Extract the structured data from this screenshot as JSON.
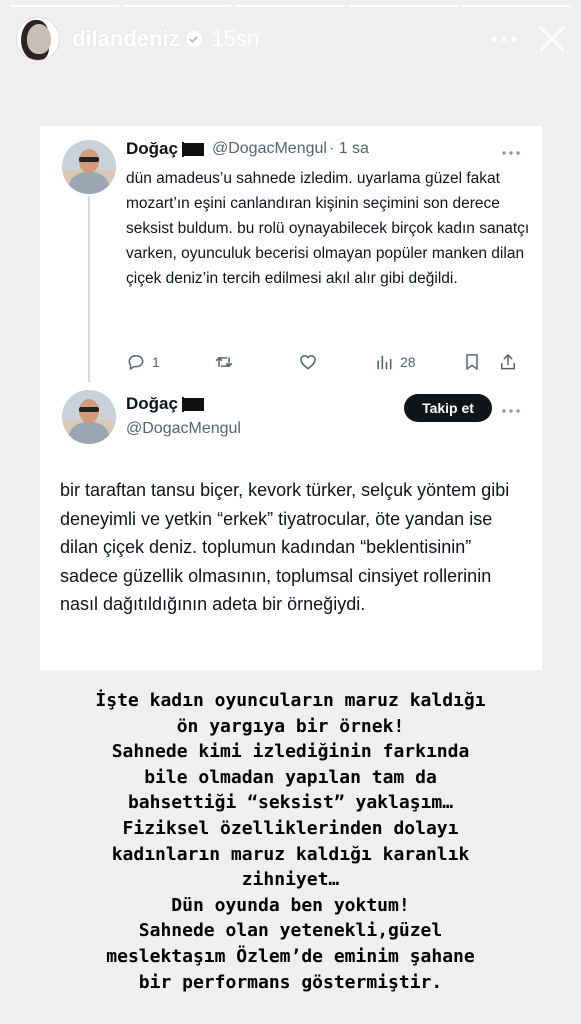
{
  "story": {
    "username": "dilandeniz",
    "time": "15sn",
    "segments": 5
  },
  "tweet1": {
    "name": "Doğaç",
    "handle": "@DogacMengul",
    "time": "· 1 sa",
    "text": "dün amadeus’u sahnede izledim. uyarlama güzel fakat mozart’ın eşini canlandıran kişinin seçimini son derece seksist buldum. bu rolü oynayabilecek birçok kadın sanatçı varken, oyunculuk becerisi olmayan popüler manken dilan çiçek deniz’in tercih edilmesi akıl alır gibi değildi.",
    "replies": "1",
    "views": "28"
  },
  "tweet2": {
    "name": "Doğaç",
    "handle": "@DogacMengul",
    "follow_label": "Takip et",
    "text": "bir taraftan tansu biçer, kevork türker, selçuk yöntem gibi deneyimli ve yetkin “erkek” tiyatrocular, öte yandan ise dilan çiçek deniz. toplumun kadından “beklentisinin” sadece güzellik olmasının, toplumsal cinsiyet rollerinin nasıl dağıtıldığının adeta bir örneğiydi."
  },
  "caption": "İşte kadın oyuncuların maruz kaldığı\nön yargıya bir örnek!\nSahnede kimi izlediğinin farkında\nbile olmadan yapılan tam da\nbahsettiği “seksist” yaklaşım…\nFiziksel özelliklerinden dolayı\nkadınların maruz kaldığı karanlık\nzihniyet…\nDün oyunda ben yoktum!\nSahnede olan yetenekli,güzel\nmeslektaşım Özlem’de eminim şahane\nbir performans göstermiştir.",
  "icons": {
    "verified": "verified-badge-icon",
    "more": "more-horizontal-icon",
    "close": "close-icon",
    "reply": "reply-icon",
    "retweet": "retweet-icon",
    "like": "like-icon",
    "views": "views-icon",
    "bookmark": "bookmark-icon",
    "share": "share-icon"
  },
  "colors": {
    "background": "#efefef",
    "card": "#ffffff",
    "text": "#0f1419",
    "secondary": "#536471",
    "follow_button": "#0f1419"
  }
}
